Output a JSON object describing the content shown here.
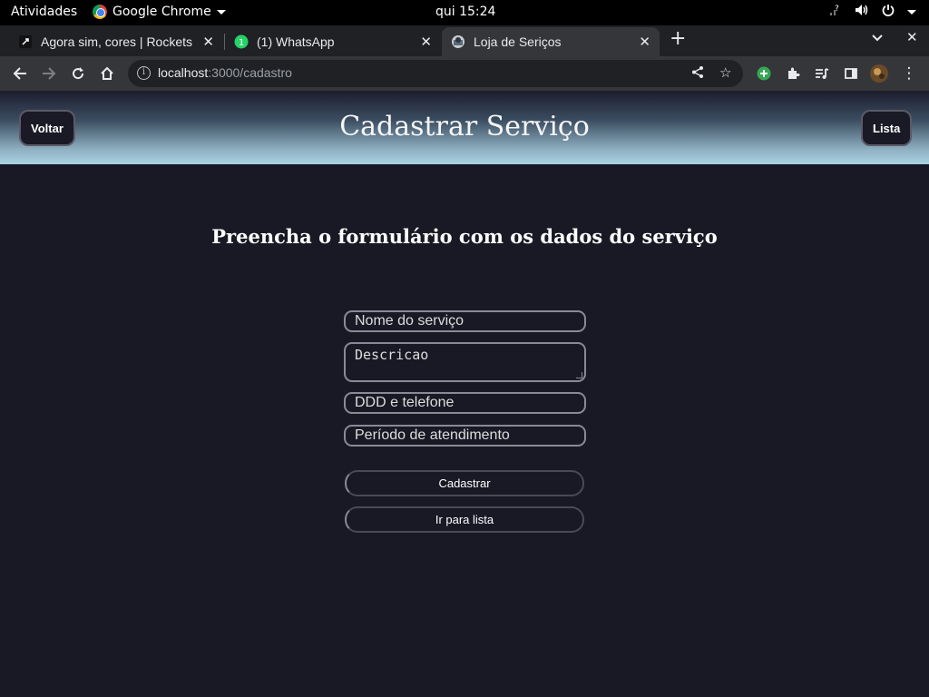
{
  "gnome": {
    "activities": "Atividades",
    "app_name": "Google Chrome",
    "clock": "qui 15:24"
  },
  "tabs": [
    {
      "title": "Agora sim, cores | Rockets",
      "favicon": "rocketseat-icon"
    },
    {
      "title": "(1) WhatsApp",
      "favicon": "whatsapp-icon",
      "badge": "1"
    },
    {
      "title": "Loja de Seriços",
      "favicon": "site-favicon",
      "active": true
    }
  ],
  "address_bar": {
    "host": "localhost",
    "path": ":3000/cadastro"
  },
  "header": {
    "back_button": "Voltar",
    "title": "Cadastrar Serviço",
    "list_button": "Lista"
  },
  "form": {
    "heading": "Preencha o formulário com os dados do serviço",
    "name_placeholder": "Nome do serviço",
    "description_placeholder": "Descricao",
    "phone_placeholder": "DDD e telefone",
    "period_placeholder": "Período de atendimento",
    "submit_label": "Cadastrar",
    "list_link_label": "Ir para lista"
  },
  "colors": {
    "page_bg": "#191926",
    "header_gradient_end": "#a9d3e2",
    "field_border": "#8a8a96"
  }
}
